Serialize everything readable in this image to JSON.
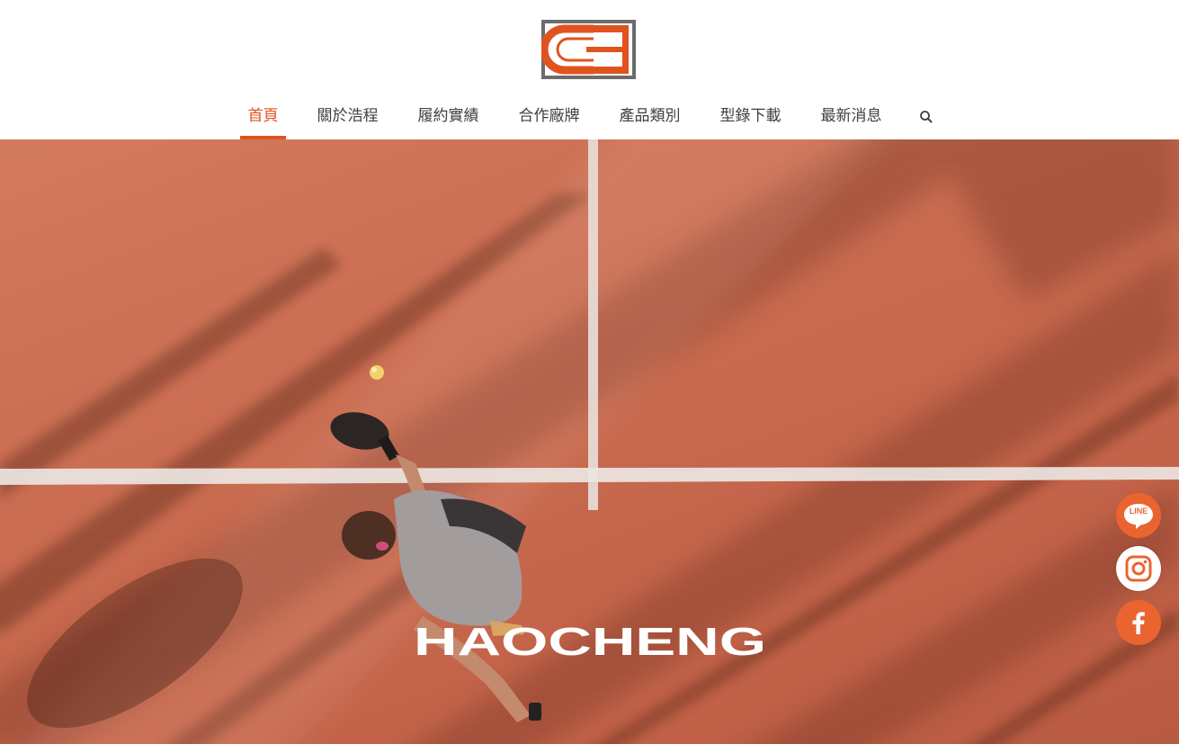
{
  "header": {
    "logo_icon": "hc-logo-icon"
  },
  "nav": {
    "items": [
      {
        "label": "首頁",
        "active": true
      },
      {
        "label": "關於浩程"
      },
      {
        "label": "履約實績"
      },
      {
        "label": "合作廠牌"
      },
      {
        "label": "產品類別"
      },
      {
        "label": "型錄下載"
      },
      {
        "label": "最新消息"
      }
    ],
    "search_icon": "search-icon"
  },
  "hero": {
    "brand_text": "HAOCHENG",
    "image": "padel-player-clay-court-photo"
  },
  "social": {
    "line_label": "LINE",
    "items": [
      "line-icon",
      "instagram-icon",
      "facebook-icon"
    ]
  },
  "colors": {
    "accent": "#e0531f",
    "nav_text": "#3f3f3f",
    "social_orange": "#ea6430",
    "court": "#c86a4f"
  }
}
